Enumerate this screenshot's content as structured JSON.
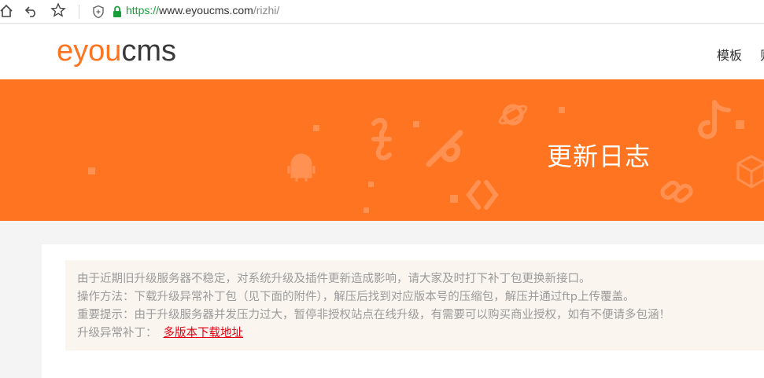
{
  "browser": {
    "url_scheme": "https://",
    "url_host": "www.eyoucms.com",
    "url_path": "/rizhi/"
  },
  "header": {
    "logo_part1": "eyou",
    "logo_part2": "cms",
    "nav_template": "模板",
    "nav_clipped": "则"
  },
  "banner": {
    "title": "更新日志"
  },
  "notice": {
    "line1": "由于近期旧升级服务器不稳定，对系统升级及插件更新造成影响，请大家及时打下补丁包更换新接口。",
    "line2": "操作方法：下载升级异常补丁包（见下面的附件），解压后找到对应版本号的压缩包，解压并通过ftp上传覆盖。",
    "line3": "重要提示：由于升级服务器并发压力过大，暂停非授权站点在线升级，有需要可以购买商业授权，如有不便请多包涵！",
    "line4_label": "升级异常补丁：",
    "line4_link": "多版本下载地址"
  },
  "colors": {
    "brand_orange": "#ff7421",
    "link_red": "#e60012",
    "lock_green": "#1a9e3b"
  }
}
